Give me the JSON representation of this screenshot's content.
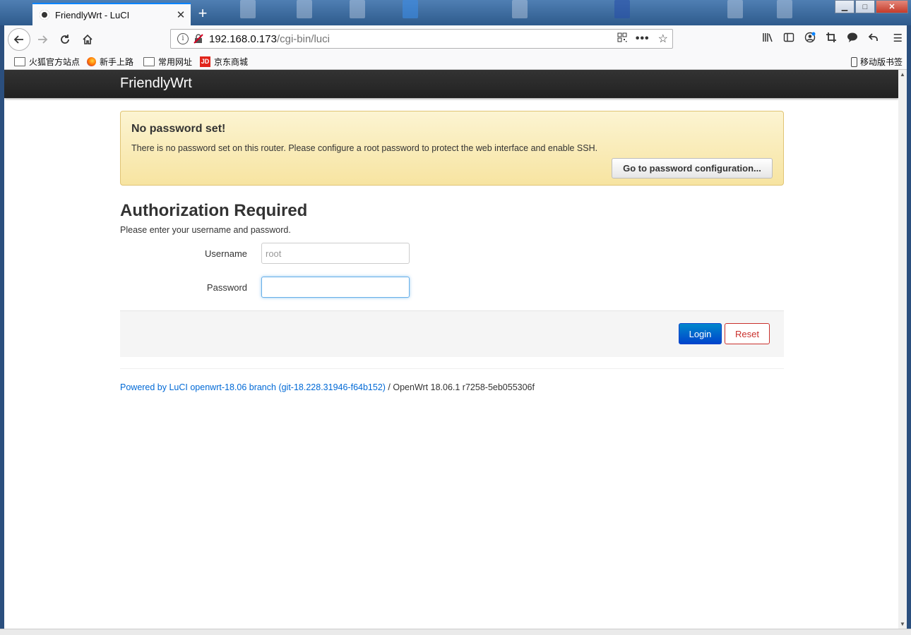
{
  "browser": {
    "tab_title": "FriendlyWrt - LuCI",
    "new_tab": "+",
    "window_controls": {
      "minimize": "▁",
      "maximize": "□",
      "close": "✕"
    },
    "url_host": "192.168.0.173",
    "url_path": "/cgi-bin/luci",
    "bookmarks": [
      {
        "label": "火狐官方站点",
        "icon": "folder-icon"
      },
      {
        "label": "新手上路",
        "icon": "firefox-icon"
      },
      {
        "label": "常用网址",
        "icon": "folder-icon"
      },
      {
        "label": "京东商城",
        "icon": "jd-icon",
        "icon_text": "JD"
      }
    ],
    "mobile_bookmarks": "移动版书签"
  },
  "page": {
    "brand": "FriendlyWrt",
    "alert": {
      "title": "No password set!",
      "text": "There is no password set on this router. Please configure a root password to protect the web interface and enable SSH.",
      "button": "Go to password configuration..."
    },
    "auth": {
      "heading": "Authorization Required",
      "subtitle": "Please enter your username and password.",
      "username_label": "Username",
      "username_placeholder": "root",
      "password_label": "Password",
      "password_value": ""
    },
    "actions": {
      "login": "Login",
      "reset": "Reset"
    },
    "footer": {
      "link_text": "Powered by LuCI openwrt-18.06 branch (git-18.228.31946-f64b152)",
      "version": " / OpenWrt 18.06.1 r7258-5eb055306f"
    }
  },
  "colors": {
    "accent": "#0a84ff",
    "header": "#222222",
    "alert_bg": "#f7e4a1",
    "login_btn": "#0044cc",
    "reset_btn": "#c9302c",
    "link": "#0069d6"
  }
}
